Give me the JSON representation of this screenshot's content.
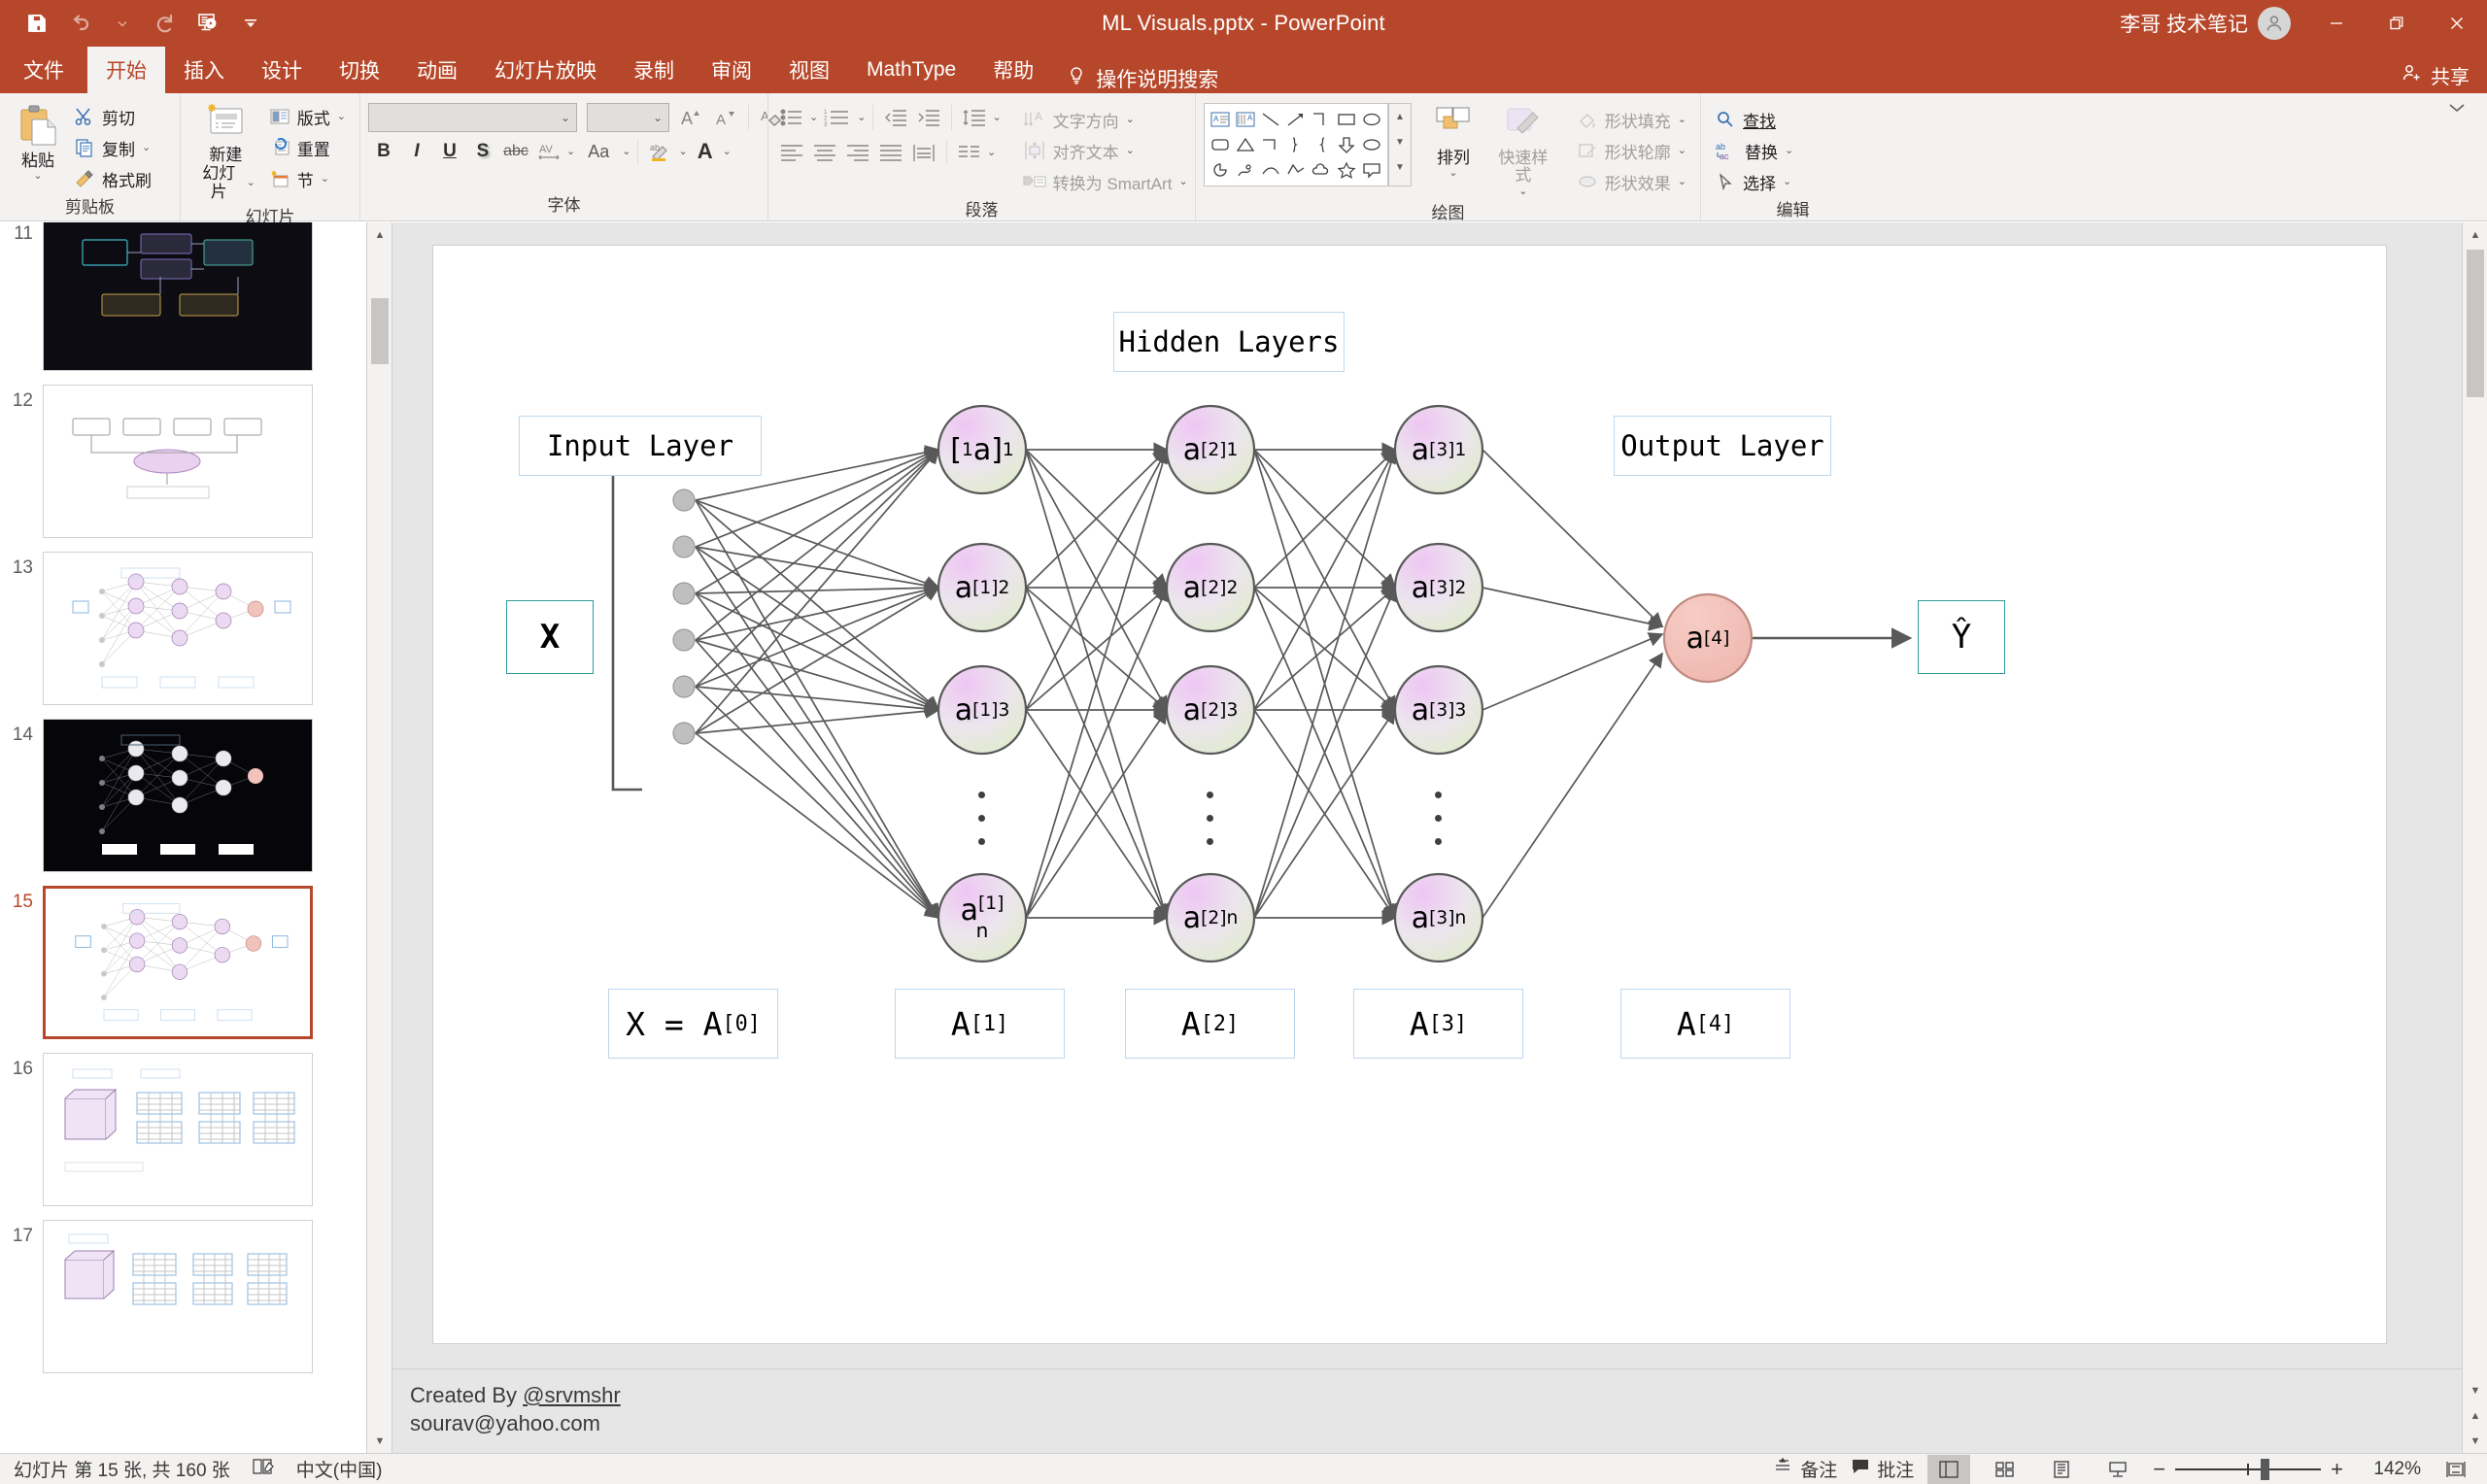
{
  "titlebar": {
    "document_title": "ML Visuals.pptx  -  PowerPoint",
    "account_name": "李哥 技术笔记",
    "qat": [
      {
        "name": "save-icon",
        "label": "保存"
      },
      {
        "name": "undo-icon",
        "label": "撤消"
      },
      {
        "name": "undo-dropdown-icon",
        "label": "撤消下拉"
      },
      {
        "name": "redo-icon",
        "label": "恢复"
      },
      {
        "name": "start-slideshow-icon",
        "label": "从头开始"
      },
      {
        "name": "customize-qat-icon",
        "label": "自定义快速访问工具栏"
      }
    ],
    "window_buttons": [
      {
        "name": "minimize-button",
        "glyph": "—"
      },
      {
        "name": "restore-button",
        "glyph": "❐"
      },
      {
        "name": "close-button",
        "glyph": "✕"
      }
    ]
  },
  "tabs": [
    {
      "id": "file",
      "label": "文件",
      "active": false
    },
    {
      "id": "home",
      "label": "开始",
      "active": true
    },
    {
      "id": "insert",
      "label": "插入",
      "active": false
    },
    {
      "id": "design",
      "label": "设计",
      "active": false
    },
    {
      "id": "transitions",
      "label": "切换",
      "active": false
    },
    {
      "id": "animations",
      "label": "动画",
      "active": false
    },
    {
      "id": "slideshow",
      "label": "幻灯片放映",
      "active": false
    },
    {
      "id": "record",
      "label": "录制",
      "active": false
    },
    {
      "id": "review",
      "label": "审阅",
      "active": false
    },
    {
      "id": "view",
      "label": "视图",
      "active": false
    },
    {
      "id": "mathtype",
      "label": "MathType",
      "active": false
    },
    {
      "id": "help",
      "label": "帮助",
      "active": false
    }
  ],
  "tell_me": {
    "label": "操作说明搜索",
    "icon": "lightbulb-icon"
  },
  "share": {
    "label": "共享",
    "icon": "share-person-icon"
  },
  "ribbon": {
    "clipboard": {
      "title": "剪贴板",
      "paste": "粘贴",
      "cut": "剪切",
      "copy": "复制",
      "format_painter": "格式刷"
    },
    "slides": {
      "title": "幻灯片",
      "new_slide": "新建\n幻灯片",
      "new_slide_line1": "新建",
      "new_slide_line2": "幻灯片",
      "layout": "版式",
      "reset": "重置",
      "section": "节"
    },
    "font": {
      "title": "字体",
      "font_name_value": "",
      "font_size_value": "",
      "buttons": [
        "B",
        "I",
        "U",
        "S",
        "abc",
        "AV",
        "Aa",
        "A"
      ]
    },
    "paragraph": {
      "title": "段落",
      "text_direction": "文字方向",
      "align_text": "对齐文本",
      "convert_smartart": "转换为 SmartArt"
    },
    "drawing": {
      "title": "绘图",
      "arrange": "排列",
      "quick_styles": "快速样式",
      "shape_fill": "形状填充",
      "shape_outline": "形状轮廓",
      "shape_effects": "形状效果"
    },
    "editing": {
      "title": "编辑",
      "find": "查找",
      "replace": "替换",
      "select": "选择"
    }
  },
  "thumbnails": [
    {
      "number": "11",
      "selected": false,
      "style": "dark"
    },
    {
      "number": "12",
      "selected": false,
      "style": "light"
    },
    {
      "number": "13",
      "selected": false,
      "style": "light"
    },
    {
      "number": "14",
      "selected": false,
      "style": "dark"
    },
    {
      "number": "15",
      "selected": true,
      "style": "light"
    },
    {
      "number": "16",
      "selected": false,
      "style": "light"
    },
    {
      "number": "17",
      "selected": false,
      "style": "light"
    }
  ],
  "slide": {
    "labels": {
      "hidden_layers": "Hidden Layers",
      "input_layer": "Input Layer",
      "output_layer": "Output Layer",
      "input_vector": "X",
      "output_yhat": "Ŷ"
    },
    "matrix_labels": [
      {
        "text": "X  =  A[0]",
        "base": "X  =  A",
        "sup": "[0]"
      },
      {
        "text": "A[1]",
        "base": "A",
        "sup": "[1]"
      },
      {
        "text": "A[2]",
        "base": "A",
        "sup": "[2]"
      },
      {
        "text": "A[3]",
        "base": "A",
        "sup": "[3]"
      },
      {
        "text": "A[4]",
        "base": "A",
        "sup": "[4]"
      }
    ],
    "layers": [
      {
        "name": "hidden-layer-1",
        "nodes": [
          {
            "base": "a",
            "sup": "[1]",
            "sub": "1",
            "raw": "[1a]1"
          },
          {
            "base": "a",
            "sup": "[1]",
            "sub": "2",
            "raw": "a[1]2"
          },
          {
            "base": "a",
            "sup": "[1]",
            "sub": "3",
            "raw": "a[1]3"
          },
          {
            "base": "a",
            "sup": "[1]",
            "sub": "n",
            "raw": "a[1]n"
          }
        ]
      },
      {
        "name": "hidden-layer-2",
        "nodes": [
          {
            "base": "a",
            "sup": "[2]",
            "sub": "1",
            "raw": "a[2]1"
          },
          {
            "base": "a",
            "sup": "[2]",
            "sub": "2",
            "raw": "a[2]2"
          },
          {
            "base": "a",
            "sup": "[2]",
            "sub": "3",
            "raw": "a[2]3"
          },
          {
            "base": "a",
            "sup": "[2]",
            "sub": "n",
            "raw": "a[2]n"
          }
        ]
      },
      {
        "name": "hidden-layer-3",
        "nodes": [
          {
            "base": "a",
            "sup": "[3]",
            "sub": "1",
            "raw": "a[3]1"
          },
          {
            "base": "a",
            "sup": "[3]",
            "sub": "2",
            "raw": "a[3]2"
          },
          {
            "base": "a",
            "sup": "[3]",
            "sub": "3",
            "raw": "a[3]3"
          },
          {
            "base": "a",
            "sup": "[3]",
            "sub": "n",
            "raw": "a[3]n"
          }
        ]
      },
      {
        "name": "output-layer",
        "nodes": [
          {
            "base": "a",
            "sup": "[4]",
            "sub": "",
            "raw": "a[4]"
          }
        ]
      }
    ],
    "input_node_count": 6,
    "colors": {
      "node_fill_start": "#e8c8ee",
      "node_fill_end": "#e3efd2",
      "output_node_fill": "#f2c3bc",
      "node_stroke": "#595959",
      "edge": "#595959",
      "label_border": "#bdd7ee",
      "input_dot": "#bfbfbf"
    }
  },
  "notes": {
    "line1_prefix": "Created By ",
    "line1_handle": "@srvmshr",
    "line2": "sourav@yahoo.com"
  },
  "statusbar": {
    "slide_counter": "幻灯片 第 15 张, 共 160 张",
    "proofing_icon": "proofing-icon",
    "language": "中文(中国)",
    "notes_label": "备注",
    "comments_label": "批注",
    "views": [
      {
        "name": "normal-view-button",
        "active": true
      },
      {
        "name": "slide-sorter-button",
        "active": false
      },
      {
        "name": "reading-view-button",
        "active": false
      },
      {
        "name": "slideshow-button",
        "active": false
      }
    ],
    "zoom_out": "−",
    "zoom_in": "+",
    "zoom_level": "142%",
    "fit_label": "fit-to-window-icon"
  }
}
